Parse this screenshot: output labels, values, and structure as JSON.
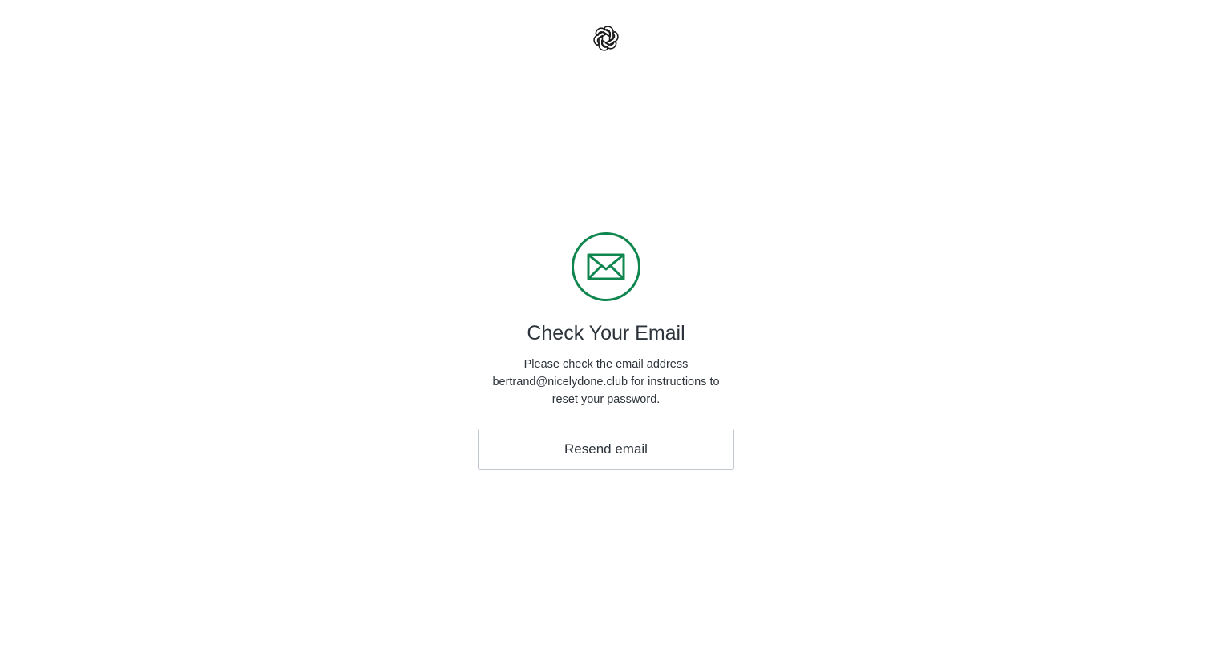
{
  "header": {
    "logo_icon": "openai-logo-icon"
  },
  "main": {
    "icon": "envelope-icon",
    "title": "Check Your Email",
    "description": "Please check the email address bertrand@nicelydone.club for instructions to reset your password.",
    "resend_label": "Resend email"
  },
  "colors": {
    "accent": "#10864f",
    "text": "#2d333a",
    "border": "#c2c8d0",
    "background": "#ffffff"
  }
}
